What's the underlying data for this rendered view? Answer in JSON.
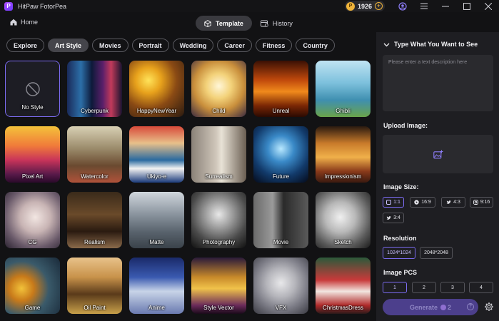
{
  "app": {
    "title": "HitPaw FotorPea",
    "coins": "1926"
  },
  "nav": {
    "home": "Home",
    "tabs": [
      "Template",
      "History"
    ],
    "active_tab": 0
  },
  "categories": [
    "Explore",
    "Art Style",
    "Movies",
    "Portrait",
    "Wedding",
    "Career",
    "Fitness",
    "Country"
  ],
  "active_category": 1,
  "styles": [
    "No Style",
    "Cyberpunk",
    "HappyNewYear",
    "Child",
    "Unreal",
    "Ghibli",
    "Pixel Art",
    "Watercolor",
    "Ukiyo-e",
    "Surrealism",
    "Future",
    "Impressionism",
    "CG",
    "Realism",
    "Matte",
    "Photography",
    "Movie",
    "Sketch",
    "Game",
    "Oil Paint",
    "Anime",
    "Style Vector",
    "VFX",
    "ChristmasDress"
  ],
  "panel": {
    "prompt_title": "Type What You Want to See",
    "prompt_placeholder": "Please enter a text description here",
    "upload_title": "Upload Image:",
    "size_title": "Image Size:",
    "sizes": [
      "1:1",
      "16:9",
      "4:3",
      "9:16",
      "3:4"
    ],
    "active_size": 0,
    "resolution_title": "Resolution",
    "resolutions": [
      "1024*1024",
      "2048*2048"
    ],
    "active_resolution": 0,
    "pcs_title": "Image PCS",
    "pcs": [
      "1",
      "2",
      "3",
      "4"
    ],
    "active_pcs": 0,
    "generate": "Generate",
    "generate_cost": "2"
  }
}
